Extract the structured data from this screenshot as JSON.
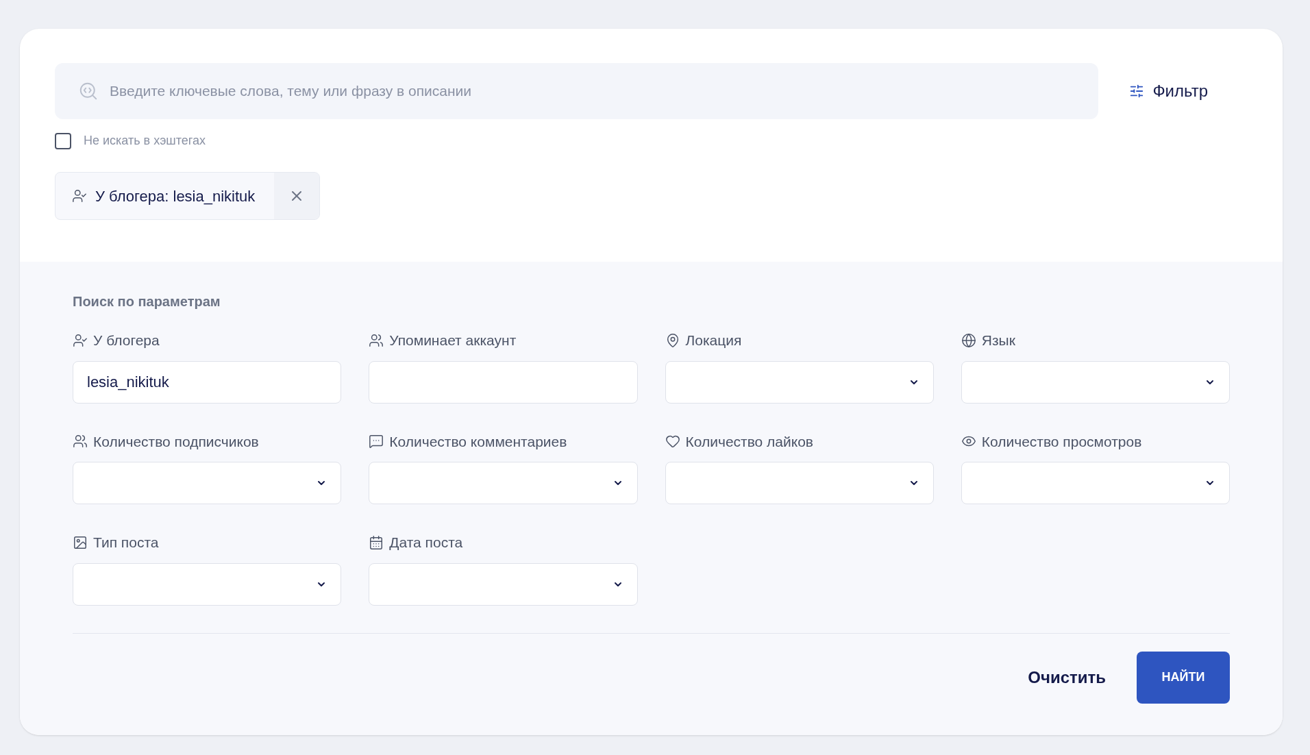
{
  "search": {
    "placeholder": "Введите ключевые слова, тему или фразу в описании"
  },
  "filter_button": {
    "label": "Фильтр"
  },
  "hashtag_option": {
    "label": "Не искать в хэштегах",
    "checked": false
  },
  "active_filters": [
    {
      "label": "У блогера: lesia_nikituk"
    }
  ],
  "parameters": {
    "title": "Поиск по параметрам",
    "fields": [
      {
        "label": "У блогера",
        "kind": "text",
        "value": "lesia_nikituk"
      },
      {
        "label": "Упоминает аккаунт",
        "kind": "text"
      },
      {
        "label": "Локация",
        "kind": "select"
      },
      {
        "label": "Язык",
        "kind": "select"
      },
      {
        "label": "Количество подписчиков",
        "kind": "select"
      },
      {
        "label": "Количество комментариев",
        "kind": "select"
      },
      {
        "label": "Количество лайков",
        "kind": "select"
      },
      {
        "label": "Количество просмотров",
        "kind": "select"
      },
      {
        "label": "Тип поста",
        "kind": "select"
      },
      {
        "label": "Дата поста",
        "kind": "select"
      }
    ]
  },
  "buttons": {
    "clear": "Очистить",
    "submit": "НАЙТИ"
  }
}
